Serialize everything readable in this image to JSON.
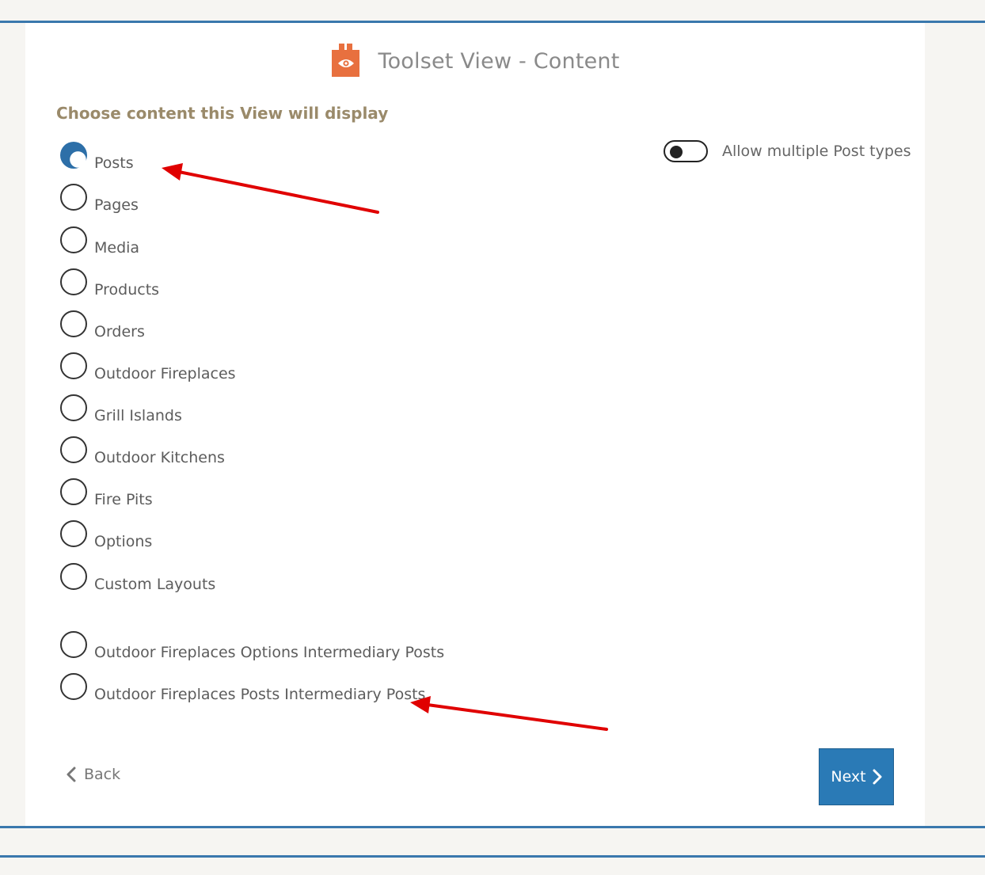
{
  "header": {
    "title": "Toolset View - Content",
    "logo_icon": "eye-icon",
    "logo_color": "#e8703f"
  },
  "section": {
    "subtitle": "Choose content this View will display"
  },
  "options": [
    {
      "label": "Posts",
      "checked": true
    },
    {
      "label": "Pages",
      "checked": false
    },
    {
      "label": "Media",
      "checked": false
    },
    {
      "label": "Products",
      "checked": false
    },
    {
      "label": "Orders",
      "checked": false
    },
    {
      "label": "Outdoor Fireplaces",
      "checked": false
    },
    {
      "label": "Grill Islands",
      "checked": false
    },
    {
      "label": "Outdoor Kitchens",
      "checked": false
    },
    {
      "label": "Fire Pits",
      "checked": false
    },
    {
      "label": "Options",
      "checked": false
    },
    {
      "label": "Custom Layouts",
      "checked": false
    },
    {
      "label": "Outdoor Fireplaces Options Intermediary Posts",
      "checked": false
    },
    {
      "label": "Outdoor Fireplaces Posts Intermediary Posts",
      "checked": false
    }
  ],
  "toggle": {
    "label": "Allow multiple Post types",
    "on": false
  },
  "footer": {
    "back_label": "Back",
    "next_label": "Next"
  },
  "colors": {
    "accent": "#2a7ab6",
    "rule": "#3a78ad",
    "annotation": "#e00000"
  }
}
